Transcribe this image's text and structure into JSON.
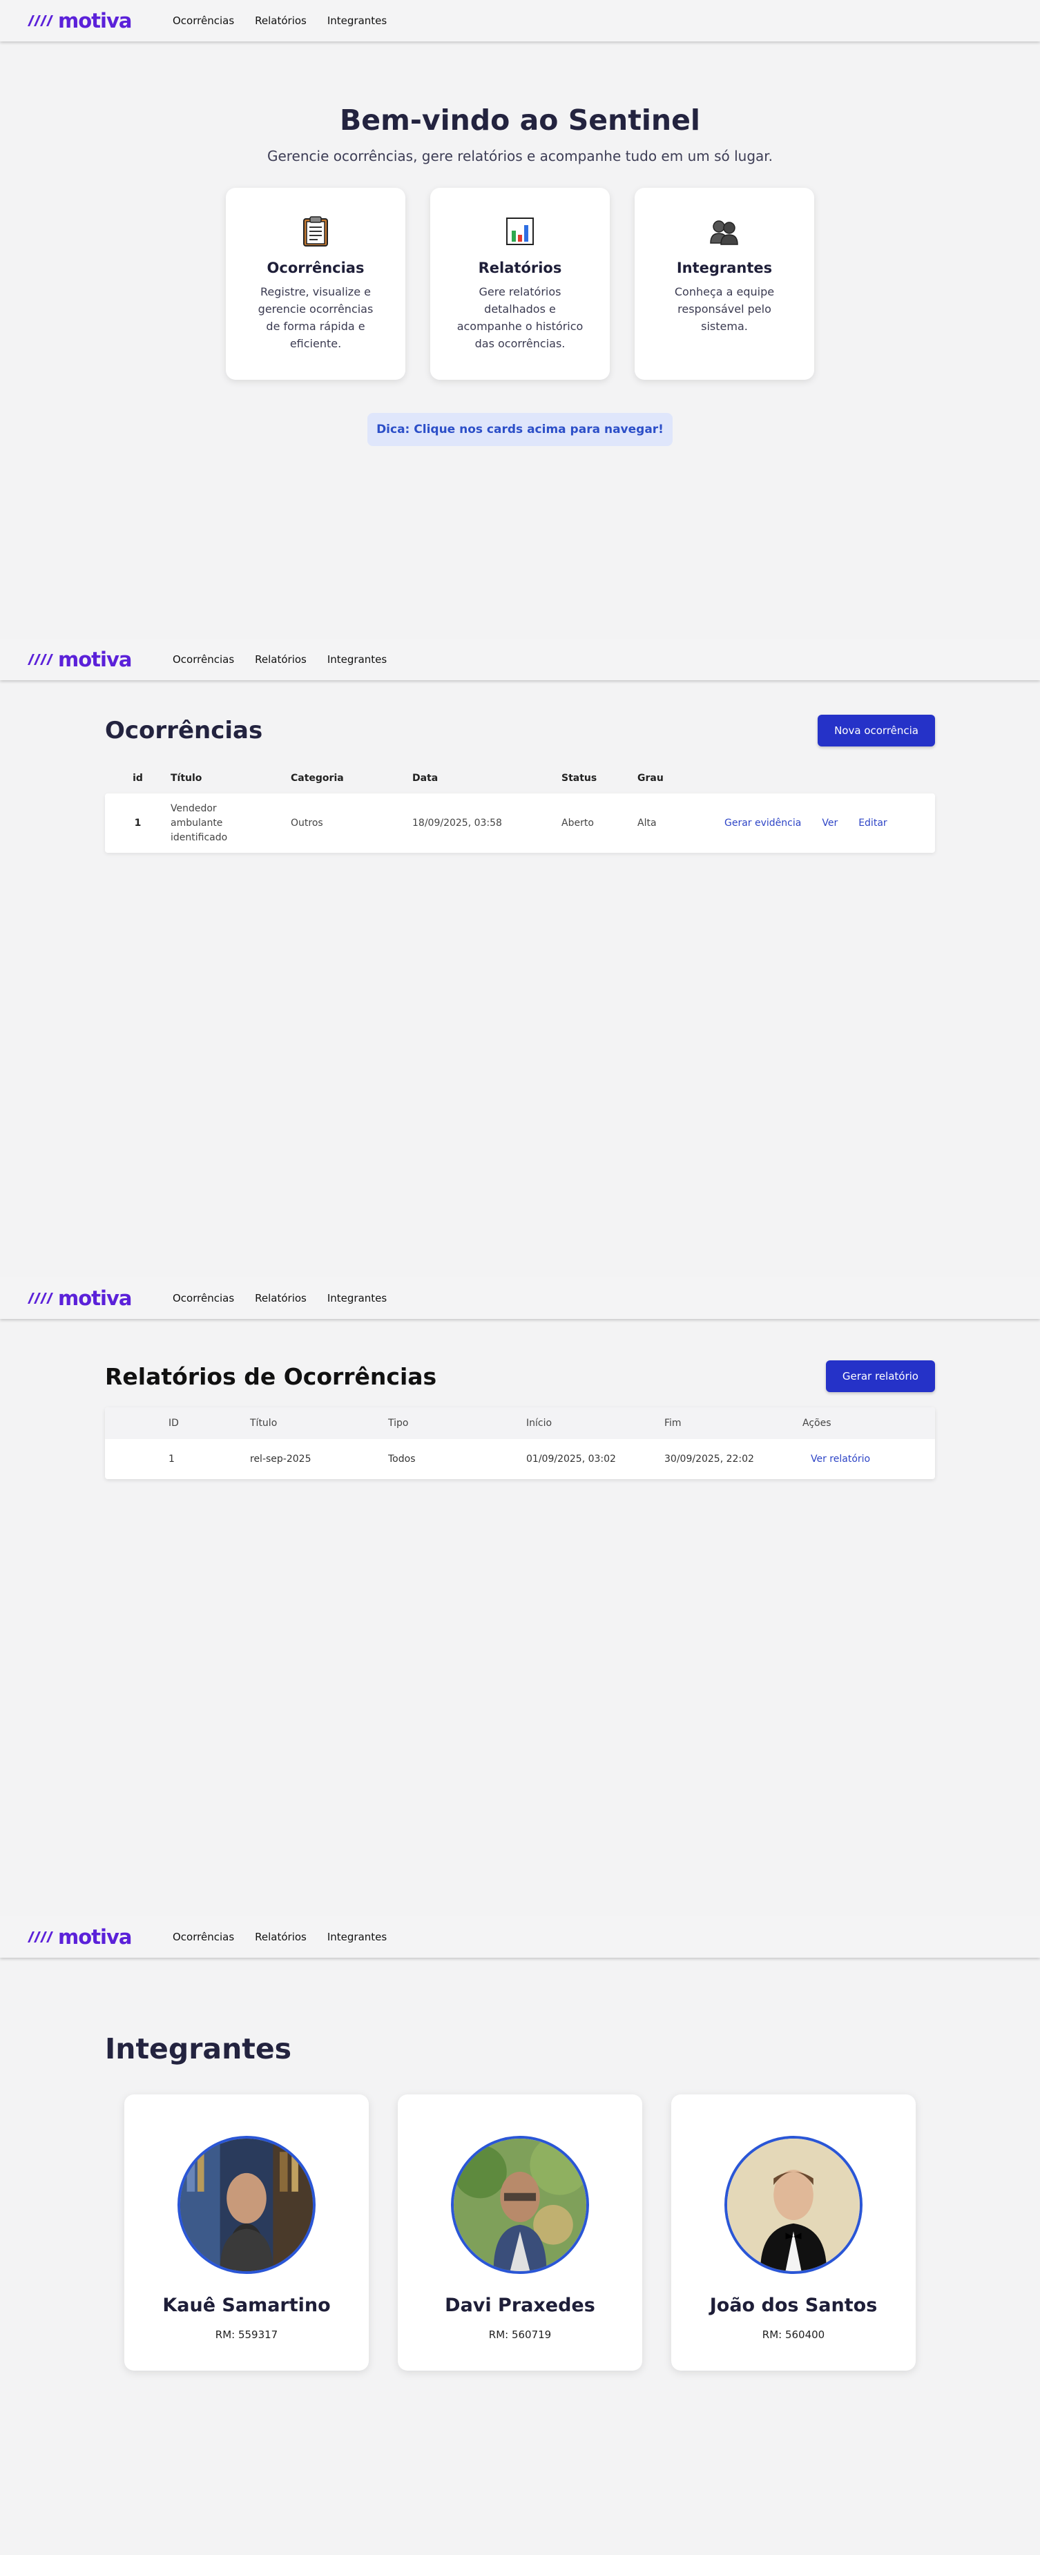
{
  "brand": {
    "name": "motiva",
    "color": "#5b21d9"
  },
  "nav": {
    "links": [
      "Ocorrências",
      "Relatórios",
      "Integrantes"
    ]
  },
  "home": {
    "title": "Bem-vindo ao Sentinel",
    "subtitle": "Gerencie ocorrências, gere relatórios e acompanhe tudo em um só lugar.",
    "cards": [
      {
        "icon": "clipboard-icon",
        "title": "Ocorrências",
        "desc": "Registre, visualize e gerencie ocorrências de forma rápida e eficiente."
      },
      {
        "icon": "bar-chart-icon",
        "title": "Relatórios",
        "desc": "Gere relatórios detalhados e acompanhe o histórico das ocorrências."
      },
      {
        "icon": "people-icon",
        "title": "Integrantes",
        "desc": "Conheça a equipe responsável pelo sistema."
      }
    ],
    "tip": "Dica: Clique nos cards acima para navegar!"
  },
  "occurrences": {
    "title": "Ocorrências",
    "new_button": "Nova ocorrência",
    "columns": [
      "id",
      "Título",
      "Categoria",
      "Data",
      "Status",
      "Grau"
    ],
    "rows": [
      {
        "id": "1",
        "title": "Vendedor ambulante identificado",
        "category": "Outros",
        "date": "18/09/2025, 03:58",
        "status": "Aberto",
        "grade": "Alta"
      }
    ],
    "row_actions": [
      "Gerar evidência",
      "Ver",
      "Editar"
    ]
  },
  "reports": {
    "title": "Relatórios de Ocorrências",
    "generate_button": "Gerar relatório",
    "columns": [
      "ID",
      "Título",
      "Tipo",
      "Início",
      "Fim",
      "Ações"
    ],
    "rows": [
      {
        "id": "1",
        "title": "rel-sep-2025",
        "type": "Todos",
        "start": "01/09/2025, 03:02",
        "end": "30/09/2025, 22:02",
        "action": "Ver relatório"
      }
    ]
  },
  "team": {
    "title": "Integrantes",
    "members": [
      {
        "name": "Kauê Samartino",
        "rm": "RM: 559317"
      },
      {
        "name": "Davi Praxedes",
        "rm": "RM: 560719"
      },
      {
        "name": "João dos Santos",
        "rm": "RM: 560400"
      }
    ]
  }
}
